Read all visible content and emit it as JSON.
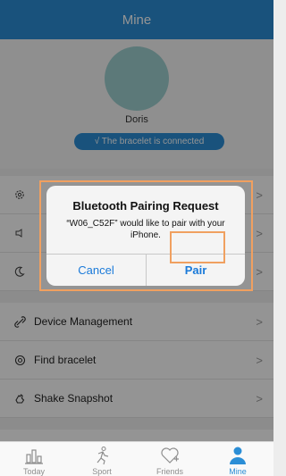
{
  "navbar": {
    "title": "Mine"
  },
  "profile": {
    "username": "Doris",
    "connection_status": "√ The bracelet is connected"
  },
  "settings_rows": [
    {
      "icon": "gear-icon"
    },
    {
      "icon": "sound-icon"
    },
    {
      "icon": "moon-icon"
    }
  ],
  "device_rows": [
    {
      "icon": "link-icon",
      "label": "Device Management"
    },
    {
      "icon": "find-icon",
      "label": "Find bracelet"
    },
    {
      "icon": "hand-icon",
      "label": "Shake Snapshot"
    }
  ],
  "dialog": {
    "title": "Bluetooth Pairing Request",
    "message": "“W06_C52F” would like to pair with your iPhone.",
    "cancel_label": "Cancel",
    "pair_label": "Pair"
  },
  "tabbar": {
    "tabs": [
      {
        "label": "Today",
        "icon": "chart-icon"
      },
      {
        "label": "Sport",
        "icon": "runner-icon"
      },
      {
        "label": "Friends",
        "icon": "heart-add-icon"
      },
      {
        "label": "Mine",
        "icon": "person-icon",
        "active": true
      }
    ]
  },
  "colors": {
    "accent": "#2b8ed6",
    "highlight": "#f0a060",
    "avatar": "#9fd0d0"
  }
}
